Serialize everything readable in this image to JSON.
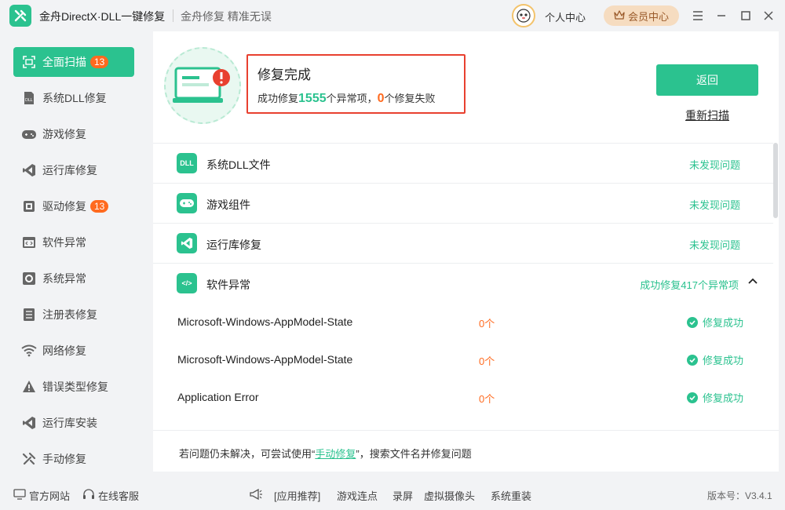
{
  "app": {
    "title": "金舟DirectX·DLL一键修复",
    "slogan": "金舟修复 精准无误",
    "user_center": "个人中心",
    "vip_center": "会员中心"
  },
  "sidebar": {
    "items": [
      {
        "label": "全面扫描",
        "badge": "13",
        "icon": "scan-icon",
        "active": true
      },
      {
        "label": "系统DLL修复",
        "icon": "dll-icon"
      },
      {
        "label": "游戏修复",
        "icon": "gamepad-icon"
      },
      {
        "label": "运行库修复",
        "icon": "runtime-icon"
      },
      {
        "label": "驱动修复",
        "badge": "13",
        "icon": "driver-icon"
      },
      {
        "label": "软件异常",
        "icon": "code-icon"
      },
      {
        "label": "系统异常",
        "icon": "gear-icon"
      },
      {
        "label": "注册表修复",
        "icon": "list-icon"
      },
      {
        "label": "网络修复",
        "icon": "wifi-icon"
      },
      {
        "label": "错误类型修复",
        "icon": "warning-icon"
      },
      {
        "label": "运行库安装",
        "icon": "install-icon"
      },
      {
        "label": "手动修复",
        "icon": "wrench-icon"
      }
    ]
  },
  "result": {
    "title": "修复完成",
    "prefix": "成功修复",
    "fixed_count": "1555",
    "middle": "个异常项，",
    "failed_count": "0",
    "suffix": "个修复失败",
    "back_label": "返回",
    "rescan_label": "重新扫描"
  },
  "categories": [
    {
      "name": "系统DLL文件",
      "status": "未发现问题",
      "icon_text": "DLL"
    },
    {
      "name": "游戏组件",
      "status": "未发现问题",
      "icon_text": "🎮"
    },
    {
      "name": "运行库修复",
      "status": "未发现问题",
      "icon_text": "VS"
    },
    {
      "name": "软件异常",
      "status": "成功修复417个异常项",
      "icon_text": "</>"
    }
  ],
  "details": [
    {
      "name": "Microsoft-Windows-AppModel-State",
      "count": "0个",
      "status": "修复成功"
    },
    {
      "name": "Microsoft-Windows-AppModel-State",
      "count": "0个",
      "status": "修复成功"
    },
    {
      "name": "Application Error",
      "count": "0个",
      "status": "修复成功"
    }
  ],
  "footer": {
    "tip_prefix": "若问题仍未解决，可尝试使用“",
    "tip_link": "手动修复",
    "tip_suffix": "”，搜索文件名并修复问题"
  },
  "bottombar": {
    "website": "官方网站",
    "support": "在线客服",
    "recommend": "[应用推荐]",
    "links": [
      "游戏连点",
      "录屏",
      "虚拟摄像头",
      "系统重装"
    ],
    "version": "版本号：V3.4.1"
  },
  "colors": {
    "accent": "#2bc28f",
    "warning": "#ff6a1f",
    "highlight_border": "#e8402f"
  }
}
